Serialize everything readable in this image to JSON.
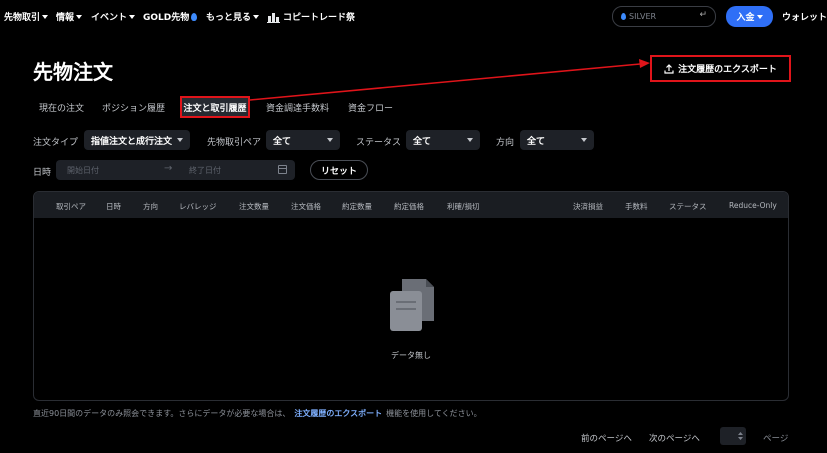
{
  "nav": {
    "items": [
      {
        "label": "先物取引",
        "has_caret": true
      },
      {
        "label": "情報",
        "has_caret": true
      },
      {
        "label": "イベント",
        "has_caret": true
      },
      {
        "label": "GOLD先物",
        "has_caret": false
      },
      {
        "label": "もっと見る",
        "has_caret": true
      },
      {
        "label": "コピートレード祭",
        "has_caret": false
      }
    ],
    "search_placeholder": "SILVER",
    "deposit_label": "入金",
    "wallet_label": "ウォレット"
  },
  "page": {
    "title": "先物注文",
    "export_label": "注文履歴のエクスポート"
  },
  "tabs": [
    {
      "label": "現在の注文",
      "active": false
    },
    {
      "label": "ポジション履歴",
      "active": false
    },
    {
      "label": "注文と取引履歴",
      "active": true
    },
    {
      "label": "資金調達手数料",
      "active": false
    },
    {
      "label": "資金フロー",
      "active": false
    }
  ],
  "filters": {
    "order_type_label": "注文タイプ",
    "order_type_value": "指値注文と成行注文",
    "pair_label": "先物取引ペア",
    "pair_value": "全て",
    "status_label": "ステータス",
    "status_value": "全て",
    "direction_label": "方向",
    "direction_value": "全て",
    "date_label": "日時",
    "start_placeholder": "開始日付",
    "end_placeholder": "終了日付",
    "reset_label": "リセット"
  },
  "table": {
    "columns": [
      "取引ペア",
      "日時",
      "方向",
      "レバレッジ",
      "注文数量",
      "注文価格",
      "約定数量",
      "約定価格",
      "利確/損切",
      "決済損益",
      "手数料",
      "ステータス",
      "Reduce-Only"
    ],
    "empty_text": "データ無し"
  },
  "footnote": {
    "before": "直近90日間のデータのみ照会できます。さらにデータが必要な場合は、",
    "link": "注文履歴のエクスポート",
    "after": "機能を使用してください。"
  },
  "pager": {
    "prev_label": "前のページへ",
    "next_label": "次のページへ",
    "unit_label": "ページ"
  },
  "colors": {
    "accent": "#2f6ff6",
    "highlight_box": "#e0141a",
    "link": "#7fb0ff"
  }
}
